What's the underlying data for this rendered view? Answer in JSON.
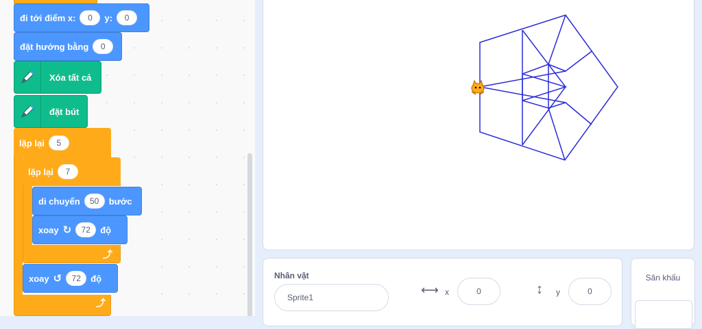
{
  "blocks": {
    "goto": {
      "label": "đi tới điểm x:",
      "x": "0",
      "y_label": "y:",
      "y": "0"
    },
    "point_direction": {
      "label": "đặt hướng bằng",
      "value": "0"
    },
    "erase_all": {
      "label": "Xóa tất cả"
    },
    "pen_down": {
      "label": "đặt bút"
    },
    "repeat_outer": {
      "label": "lặp lại",
      "value": "5"
    },
    "repeat_inner": {
      "label": "lặp lại",
      "value": "7"
    },
    "move": {
      "label": "di chuyển",
      "value": "50",
      "suffix": "bước"
    },
    "turn_right": {
      "label": "xoay",
      "value": "72",
      "suffix": "độ"
    },
    "turn_left": {
      "label": "xoay",
      "value": "72",
      "suffix": "độ"
    }
  },
  "sprite_info": {
    "sprite_label": "Nhân vật",
    "sprite_name": "Sprite1",
    "x_label": "x",
    "x_value": "0",
    "y_label": "y",
    "y_value": "0"
  },
  "stage_panel": {
    "label": "Sân khấu"
  },
  "colors": {
    "motion": "#4c97ff",
    "control": "#ffab19",
    "pen": "#0fbd8c",
    "drawing": "#2b2bd9"
  }
}
